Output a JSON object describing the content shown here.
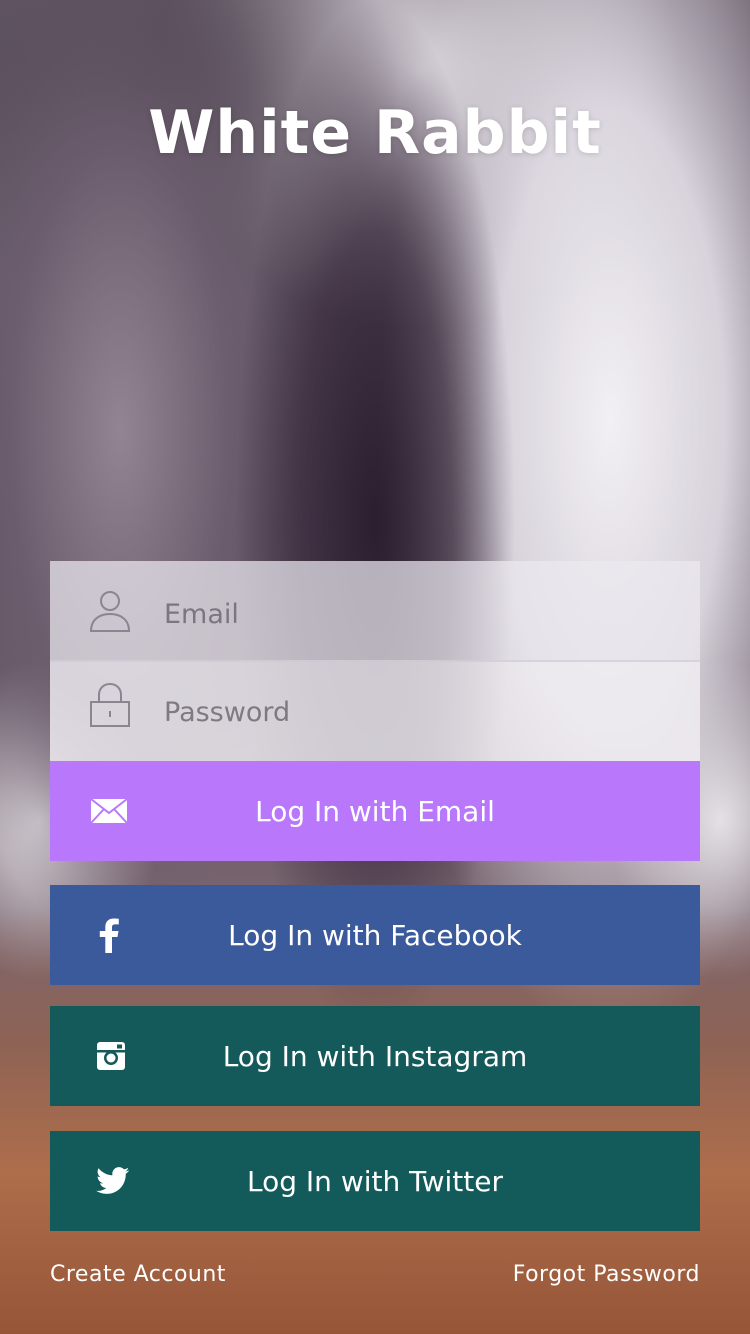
{
  "app": {
    "title": "White Rabbit"
  },
  "form": {
    "email": {
      "placeholder": "Email",
      "value": "",
      "icon": "user-icon"
    },
    "password": {
      "placeholder": "Password",
      "value": "",
      "icon": "lock-icon"
    }
  },
  "buttons": {
    "email": {
      "label": "Log In with Email",
      "icon": "envelope-icon",
      "color": "#b978fb"
    },
    "facebook": {
      "label": "Log In with Facebook",
      "icon": "facebook-icon",
      "color": "#3b5a9b"
    },
    "instagram": {
      "label": "Log In with Instagram",
      "icon": "instagram-icon",
      "color": "#145a5a"
    },
    "twitter": {
      "label": "Log In with Twitter",
      "icon": "twitter-icon",
      "color": "#135b5b"
    }
  },
  "footer": {
    "create_account": "Create Account",
    "forgot_password": "Forgot Password"
  }
}
